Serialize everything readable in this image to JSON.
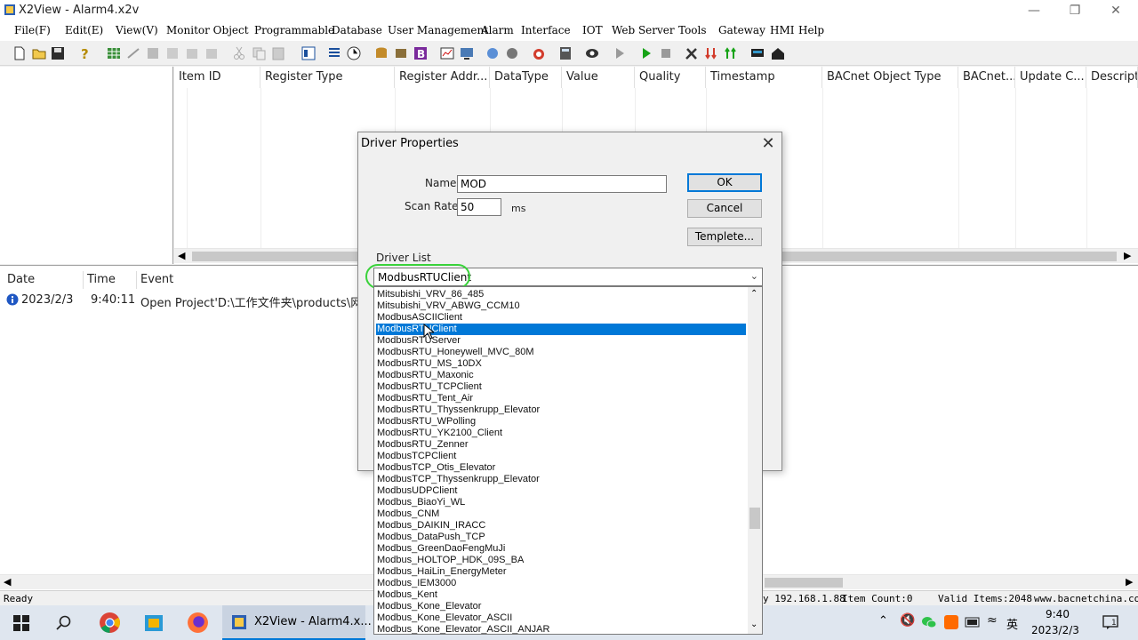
{
  "window": {
    "title": "X2View - Alarm4.x2v"
  },
  "menu": [
    "File(F)",
    "Edit(E)",
    "View(V)",
    "Monitor Object",
    "Programmable",
    "Database",
    "User Management",
    "Alarm",
    "Interface",
    "IOT",
    "Web Server",
    "Tools",
    "Gateway",
    "HMI",
    "Help"
  ],
  "grid": {
    "columns": [
      "Item ID",
      "Register Type",
      "Register Addr...",
      "DataType",
      "Value",
      "Quality",
      "Timestamp",
      "BACnet Object Type",
      "BACnet...",
      "Update C...",
      "Descripti"
    ]
  },
  "log": {
    "columns": [
      "Date",
      "Time",
      "Event"
    ],
    "rows": [
      {
        "date": "2023/2/3",
        "time": "9:40:11",
        "event": "Open Project'D:\\工作文件夹\\products\\网关"
      }
    ]
  },
  "status": {
    "ready": "Ready",
    "ip": "y 192.168.1.88",
    "item_count": "Item Count:0",
    "valid_items": "Valid Items:2048",
    "site": "www.bacnetchina.com"
  },
  "dialog": {
    "title": "Driver Properties",
    "name_label": "Name:",
    "name_value": "MOD",
    "scan_label": "Scan Rate:",
    "scan_value": "50",
    "scan_unit": "ms",
    "ok": "OK",
    "cancel": "Cancel",
    "template": "Templete...",
    "driver_list_label": "Driver List",
    "selected_driver": "ModbusRTUClient",
    "drivers": [
      "Mitsubishi_VRV_86_485",
      "Mitsubishi_VRV_ABWG_CCM10",
      "ModbusASCIIClient",
      "ModbusRTUClient",
      "ModbusRTUServer",
      "ModbusRTU_Honeywell_MVC_80M",
      "ModbusRTU_MS_10DX",
      "ModbusRTU_Maxonic",
      "ModbusRTU_TCPClient",
      "ModbusRTU_Tent_Air",
      "ModbusRTU_Thyssenkrupp_Elevator",
      "ModbusRTU_WPolling",
      "ModbusRTU_YK2100_Client",
      "ModbusRTU_Zenner",
      "ModbusTCPClient",
      "ModbusTCP_Otis_Elevator",
      "ModbusTCP_Thyssenkrupp_Elevator",
      "ModbusUDPClient",
      "Modbus_BiaoYi_WL",
      "Modbus_CNM",
      "Modbus_DAIKIN_IRACC",
      "Modbus_DataPush_TCP",
      "Modbus_GreenDaoFengMuJi",
      "Modbus_HOLTOP_HDK_09S_BA",
      "Modbus_HaiLin_EnergyMeter",
      "Modbus_IEM3000",
      "Modbus_Kent",
      "Modbus_Kone_Elevator",
      "Modbus_Kone_Elevator_ASCII",
      "Modbus_Kone_Elevator_ASCII_ANJAR"
    ],
    "selected_index": 3
  },
  "taskbar": {
    "task_label": "X2View - Alarm4.x...",
    "time": "9:40",
    "date": "2023/2/3",
    "ime": "英"
  },
  "colors": {
    "selection": "#0078d7",
    "highlight_ring": "#39d23a",
    "taskbar": "#dfe6ef"
  }
}
